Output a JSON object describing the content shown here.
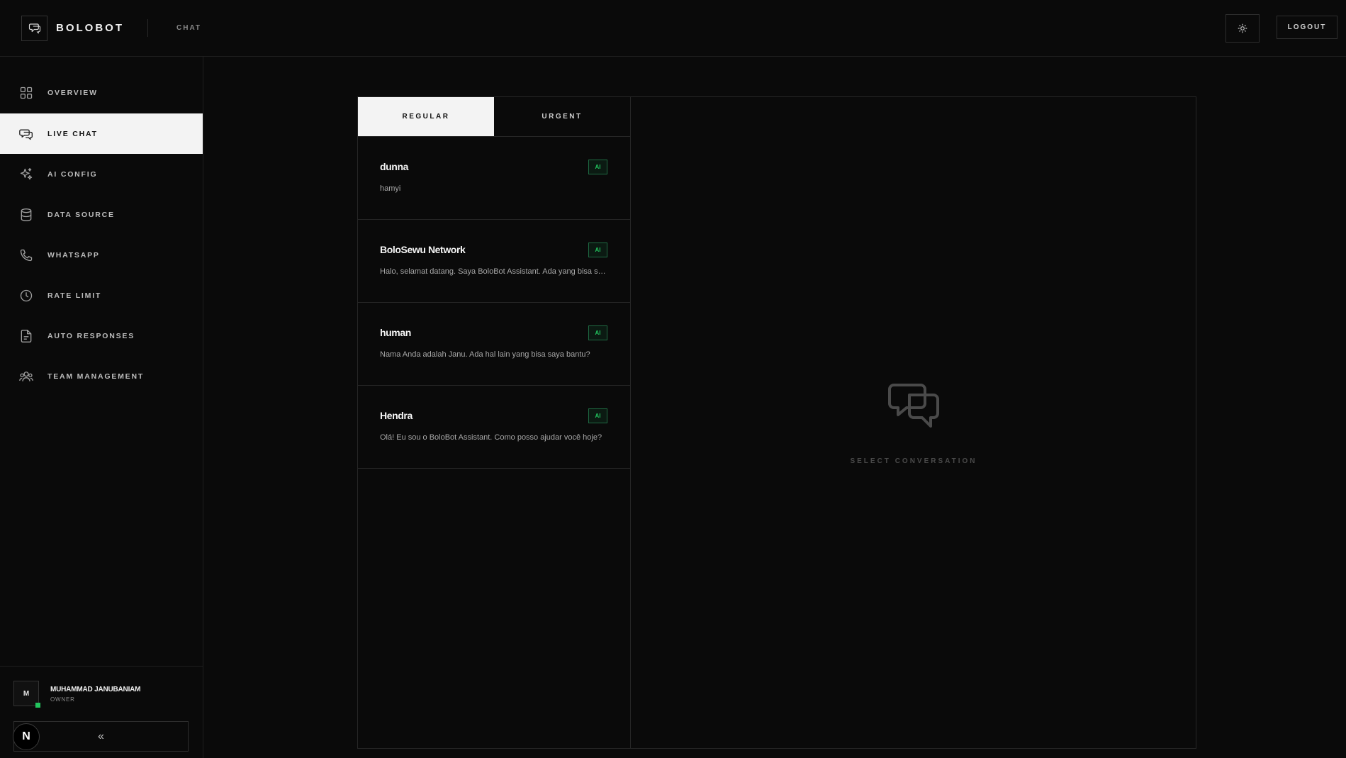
{
  "header": {
    "app_name": "BOLOBOT",
    "section": "CHAT",
    "logout_label": "LOGOUT"
  },
  "sidebar": {
    "items": [
      {
        "label": "OVERVIEW",
        "icon": "grid-icon"
      },
      {
        "label": "LIVE CHAT",
        "icon": "chat-icon",
        "active": true
      },
      {
        "label": "AI CONFIG",
        "icon": "sparkles-icon"
      },
      {
        "label": "DATA SOURCE",
        "icon": "database-icon"
      },
      {
        "label": "WHATSAPP",
        "icon": "phone-icon"
      },
      {
        "label": "RATE LIMIT",
        "icon": "clock-icon"
      },
      {
        "label": "AUTO RESPONSES",
        "icon": "file-icon"
      },
      {
        "label": "TEAM MANAGEMENT",
        "icon": "users-icon"
      }
    ],
    "user": {
      "initial": "M",
      "name": "MUHAMMAD JANUBANIAM",
      "role": "OWNER"
    },
    "collapse_glyph": "«"
  },
  "chat": {
    "tabs": [
      {
        "label": "REGULAR",
        "active": true
      },
      {
        "label": "URGENT",
        "active": false
      }
    ],
    "conversations": [
      {
        "name": "dunna",
        "message": "hamyi",
        "badge": "AI"
      },
      {
        "name": "BoloSewu Network",
        "message": "Halo, selamat datang. Saya BoloBot Assistant. Ada yang bisa saya bantu?",
        "badge": "AI"
      },
      {
        "name": "human",
        "message": "Nama Anda adalah Janu. Ada hal lain yang bisa saya bantu?",
        "badge": "AI"
      },
      {
        "name": "Hendra",
        "message": "Olá! Eu sou o BoloBot Assistant. Como posso ajudar você hoje?",
        "badge": "AI"
      }
    ],
    "empty_state": "SELECT CONVERSATION"
  },
  "next_badge": "N",
  "colors": {
    "background": "#0a0a0a",
    "accent_green": "#22c55e",
    "active_bg": "#f3f3f3"
  }
}
